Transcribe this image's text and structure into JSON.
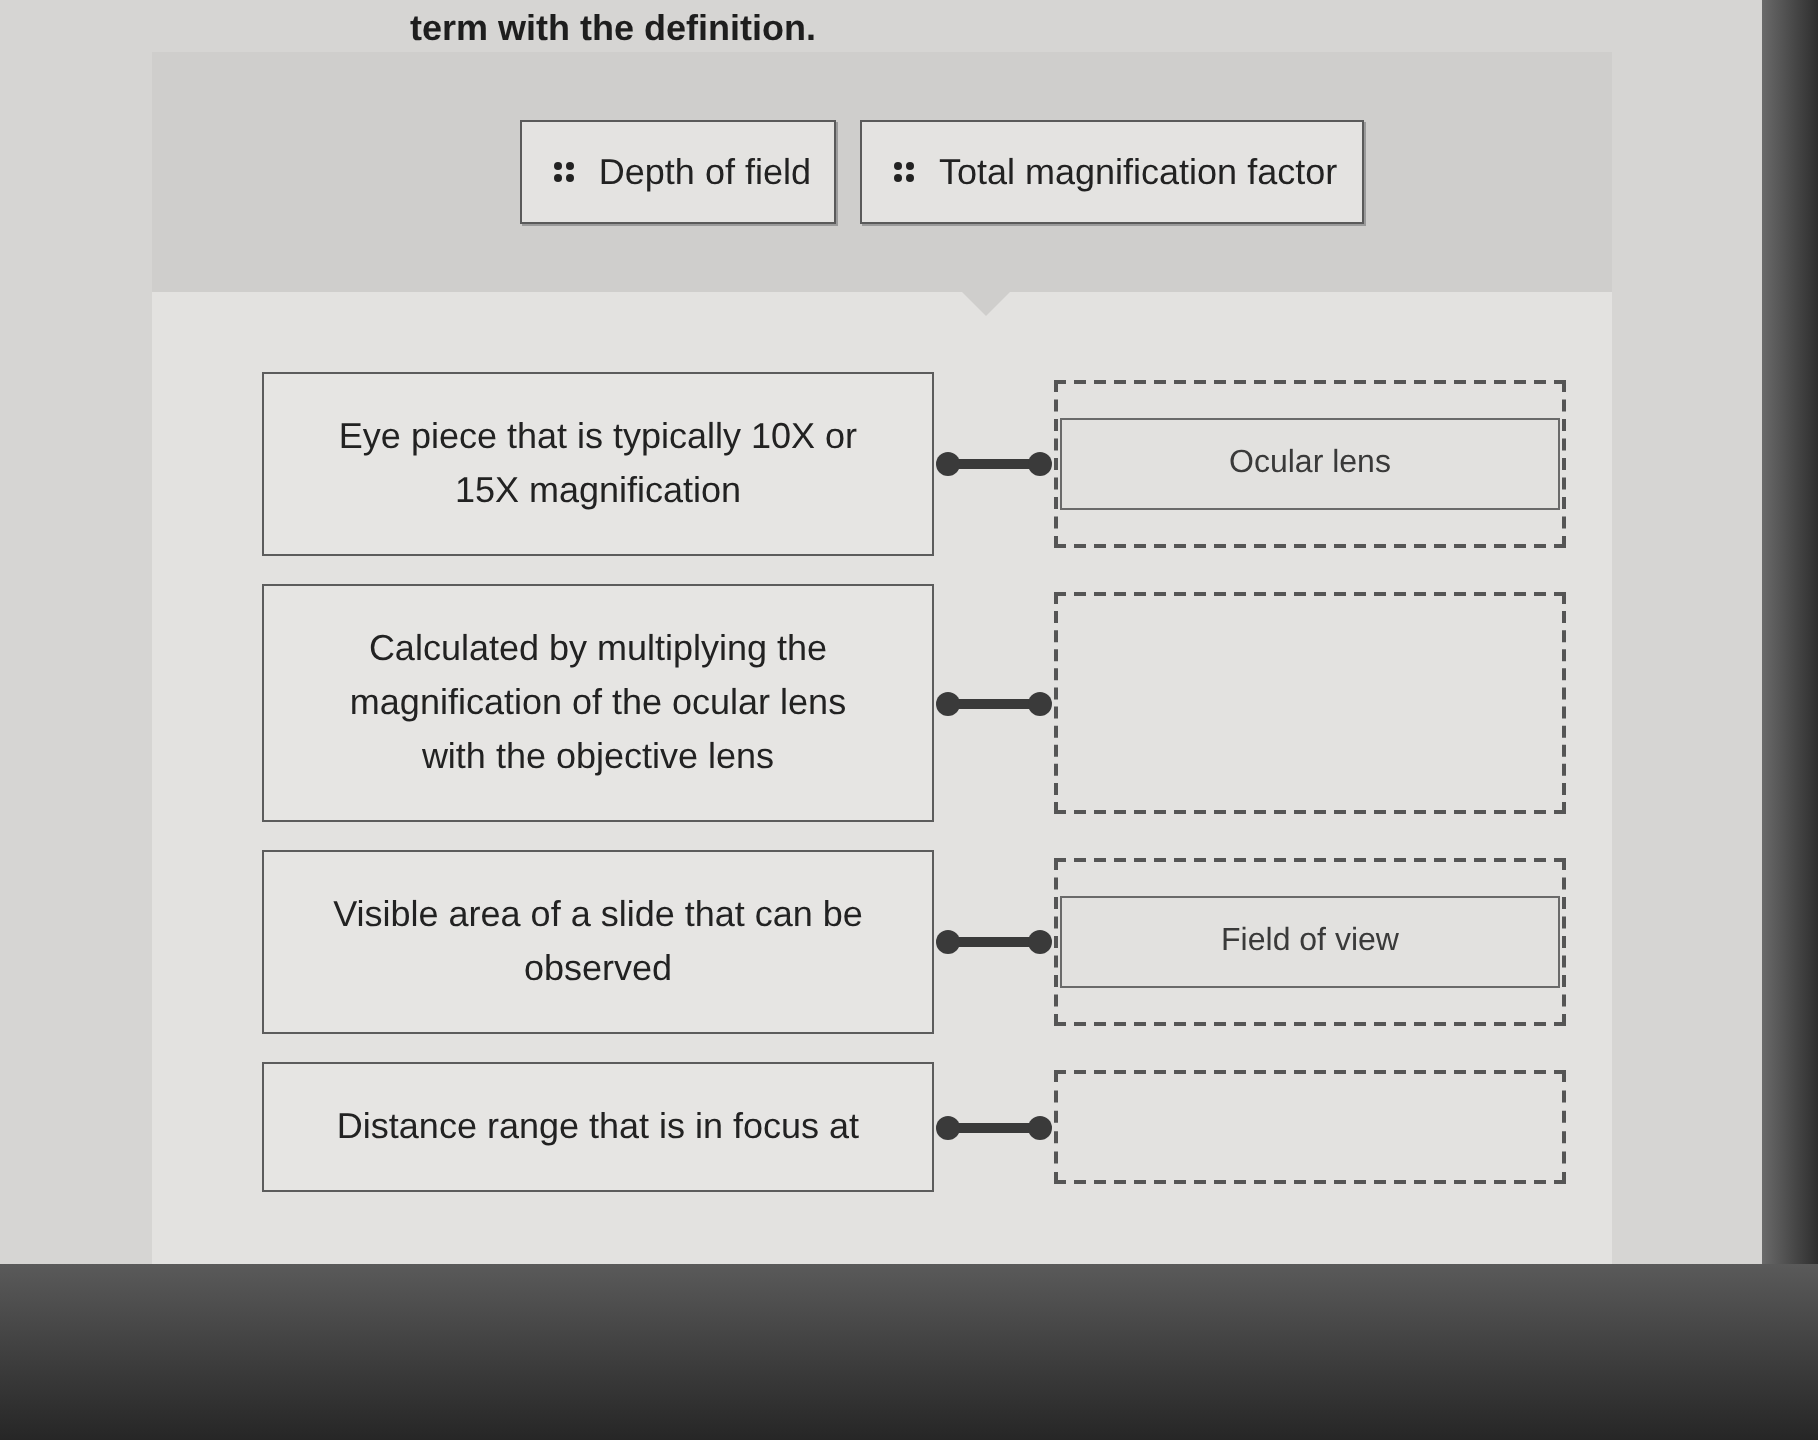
{
  "instructions": "term with the definition.",
  "term_bank": {
    "terms": [
      {
        "label": "Depth of field"
      },
      {
        "label": "Total magnification factor"
      }
    ]
  },
  "pairs": [
    {
      "definition": "Eye piece that is typically 10X or 15X magnification",
      "placed_term": "Ocular lens"
    },
    {
      "definition": "Calculated by multiplying the magnification of the ocular lens with the objective lens"
    },
    {
      "definition": "Visible area of a slide that can be observed",
      "placed_term": "Field of view"
    },
    {
      "definition": "Distance range that is in focus at"
    }
  ]
}
